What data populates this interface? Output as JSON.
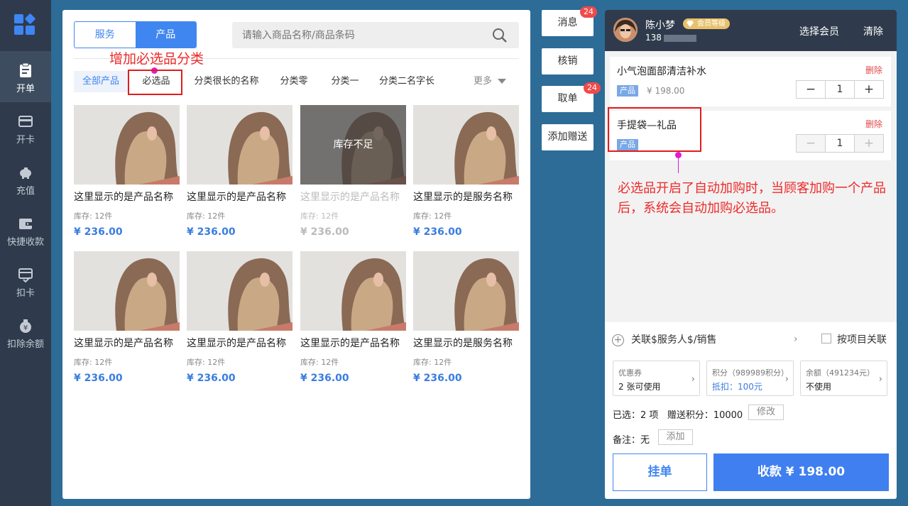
{
  "sidebar": {
    "items": [
      {
        "label": "开单",
        "icon": "clipboard-icon",
        "active": true
      },
      {
        "label": "开卡",
        "icon": "card-icon"
      },
      {
        "label": "充值",
        "icon": "piggy-bank-icon"
      },
      {
        "label": "快捷收款",
        "icon": "wallet-icon"
      },
      {
        "label": "扣卡",
        "icon": "card-check-icon"
      },
      {
        "label": "扣除余额",
        "icon": "money-bag-icon"
      }
    ]
  },
  "products": {
    "segment": {
      "service": "服务",
      "product": "产品"
    },
    "search_placeholder": "请输入商品名称/商品条码",
    "annotation_top": "增加必选品分类",
    "categories": [
      "全部产品",
      "必选品",
      "分类很长的名称",
      "分类零",
      "分类一",
      "分类二名字长"
    ],
    "more": "更多",
    "grid": [
      {
        "name": "这里显示的是产品名称",
        "stock": "库存: 12件",
        "price": "¥ 236.00"
      },
      {
        "name": "这里显示的是产品名称",
        "stock": "库存: 12件",
        "price": "¥ 236.00"
      },
      {
        "name": "这里显示的是产品名称",
        "stock": "库存: 12件",
        "price": "¥ 236.00",
        "overlay": "库存不足"
      },
      {
        "name": "这里显示的是服务名称",
        "stock": "库存: 12件",
        "price": "¥ 236.00"
      },
      {
        "name": "这里显示的是产品名称",
        "stock": "库存: 12件",
        "price": "¥ 236.00"
      },
      {
        "name": "这里显示的是产品名称",
        "stock": "库存: 12件",
        "price": "¥ 236.00"
      },
      {
        "name": "这里显示的是产品名称",
        "stock": "库存: 12件",
        "price": "¥ 236.00"
      },
      {
        "name": "这里显示的是服务名称",
        "stock": "库存: 12件",
        "price": "¥ 236.00"
      }
    ]
  },
  "actions": {
    "message": "消息",
    "message_badge": "24",
    "verify": "核销",
    "take_order": "取单",
    "take_order_badge": "24",
    "add_gift": "添加赠送"
  },
  "cart": {
    "member_name": "陈小梦",
    "member_level": "会员等级",
    "member_phone": "138",
    "choose_member": "选择会员",
    "clear": "清除",
    "items": [
      {
        "name": "小气泡面部清洁补水",
        "tag": "产品",
        "price": "¥ 198.00",
        "delete": "删除",
        "qty": "1"
      },
      {
        "name": "手提袋—礼品",
        "tag": "产品",
        "price": "",
        "delete": "删除",
        "qty": "1"
      }
    ],
    "annotation": "必选品开启了自动加购时，当顾客加购一个产品后，系统会自动加购必选品。",
    "link_staff": "关联$服务人$/销售",
    "by_item": "按项目关联",
    "coupon": {
      "title": "优惠券",
      "sub": "2 张可使用"
    },
    "points": {
      "title": "积分（989989积分）",
      "sub": "抵扣：100元"
    },
    "balance": {
      "title": "余额（491234元）",
      "sub": "不使用"
    },
    "selected": "已选：2 项",
    "gift_points": "赠送积分：10000",
    "modify": "修改",
    "remark": "备注：无",
    "add": "添加",
    "hold": "挂单",
    "pay": "收款 ¥ 198.00"
  },
  "colors": {
    "accent": "#3f86f0",
    "sidebar": "#2f3b4c",
    "annotation": "#ee2a2a",
    "highlight": "#e31bd0"
  }
}
